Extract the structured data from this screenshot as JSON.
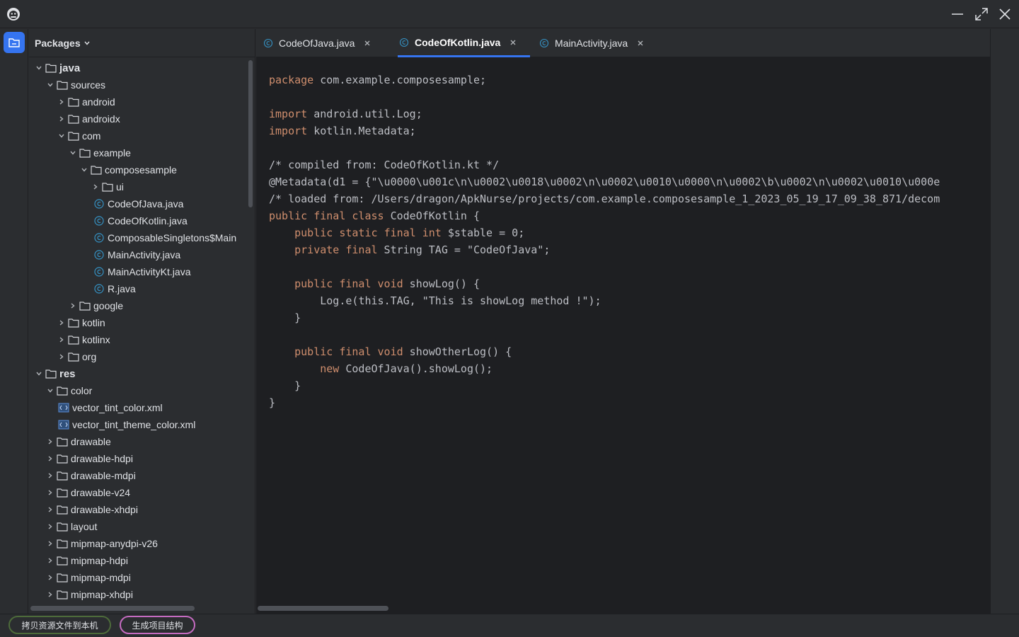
{
  "titlebar": {
    "logo_icon": "android-bug-icon",
    "buttons": [
      "minimize-icon",
      "maximize-icon",
      "close-icon"
    ]
  },
  "strip": {
    "active_icon": "folder-icon",
    "accent": "#3574f0"
  },
  "panel": {
    "title": "Packages",
    "tree": [
      {
        "label": "java",
        "depth": 0,
        "type": "folder",
        "expanded": true,
        "big": true
      },
      {
        "label": "sources",
        "depth": 1,
        "type": "folder",
        "expanded": true
      },
      {
        "label": "android",
        "depth": 2,
        "type": "folder",
        "expanded": false
      },
      {
        "label": "androidx",
        "depth": 2,
        "type": "folder",
        "expanded": false
      },
      {
        "label": "com",
        "depth": 2,
        "type": "folder",
        "expanded": true
      },
      {
        "label": "example",
        "depth": 3,
        "type": "folder",
        "expanded": true
      },
      {
        "label": "composesample",
        "depth": 4,
        "type": "folder",
        "expanded": true
      },
      {
        "label": "ui",
        "depth": 5,
        "type": "folder",
        "expanded": false
      },
      {
        "label": "CodeOfJava.java",
        "depth": 5,
        "type": "class"
      },
      {
        "label": "CodeOfKotlin.java",
        "depth": 5,
        "type": "class"
      },
      {
        "label": "ComposableSingletons$Main",
        "depth": 5,
        "type": "class"
      },
      {
        "label": "MainActivity.java",
        "depth": 5,
        "type": "class"
      },
      {
        "label": "MainActivityKt.java",
        "depth": 5,
        "type": "class"
      },
      {
        "label": "R.java",
        "depth": 5,
        "type": "class"
      },
      {
        "label": "google",
        "depth": 3,
        "type": "folder",
        "expanded": false
      },
      {
        "label": "kotlin",
        "depth": 2,
        "type": "folder",
        "expanded": false
      },
      {
        "label": "kotlinx",
        "depth": 2,
        "type": "folder",
        "expanded": false
      },
      {
        "label": "org",
        "depth": 2,
        "type": "folder",
        "expanded": false
      },
      {
        "label": "res",
        "depth": 0,
        "type": "folder",
        "expanded": true,
        "big": true
      },
      {
        "label": "color",
        "depth": 1,
        "type": "folder",
        "expanded": true
      },
      {
        "label": "vector_tint_color.xml",
        "depth": 2,
        "type": "xml"
      },
      {
        "label": "vector_tint_theme_color.xml",
        "depth": 2,
        "type": "xml"
      },
      {
        "label": "drawable",
        "depth": 1,
        "type": "folder",
        "expanded": false
      },
      {
        "label": "drawable-hdpi",
        "depth": 1,
        "type": "folder",
        "expanded": false
      },
      {
        "label": "drawable-mdpi",
        "depth": 1,
        "type": "folder",
        "expanded": false
      },
      {
        "label": "drawable-v24",
        "depth": 1,
        "type": "folder",
        "expanded": false
      },
      {
        "label": "drawable-xhdpi",
        "depth": 1,
        "type": "folder",
        "expanded": false
      },
      {
        "label": "layout",
        "depth": 1,
        "type": "folder",
        "expanded": false
      },
      {
        "label": "mipmap-anydpi-v26",
        "depth": 1,
        "type": "folder",
        "expanded": false
      },
      {
        "label": "mipmap-hdpi",
        "depth": 1,
        "type": "folder",
        "expanded": false
      },
      {
        "label": "mipmap-mdpi",
        "depth": 1,
        "type": "folder",
        "expanded": false
      },
      {
        "label": "mipmap-xhdpi",
        "depth": 1,
        "type": "folder",
        "expanded": false
      }
    ]
  },
  "editor": {
    "tabs": [
      {
        "label": "CodeOfJava.java",
        "active": false
      },
      {
        "label": "CodeOfKotlin.java",
        "active": true
      },
      {
        "label": "MainActivity.java",
        "active": false
      }
    ],
    "code_lines": [
      "package com.example.composesample;",
      "",
      "import android.util.Log;",
      "import kotlin.Metadata;",
      "",
      "/* compiled from: CodeOfKotlin.kt */",
      "@Metadata(d1 = {\"\\u0000\\u001c\\n\\u0002\\u0018\\u0002\\n\\u0002\\u0010\\u0000\\n\\u0002\\b\\u0002\\n\\u0002\\u0010\\u000e",
      "/* loaded from: /Users/dragon/ApkNurse/projects/com.example.composesample_1_2023_05_19_17_09_38_871/decom",
      "public final class CodeOfKotlin {",
      "    public static final int $stable = 0;",
      "    private final String TAG = \"CodeOfJava\";",
      "",
      "    public final void showLog() {",
      "        Log.e(this.TAG, \"This is showLog method !\");",
      "    }",
      "",
      "    public final void showOtherLog() {",
      "        new CodeOfJava().showLog();",
      "    }",
      "}"
    ],
    "keywords": [
      "package",
      "import",
      "public",
      "final",
      "class",
      "static",
      "int",
      "private",
      "void",
      "new"
    ],
    "colors": {
      "keyword": "#cf8e6d",
      "text": "#bcbec4",
      "background": "#1e1f22"
    }
  },
  "bottom": {
    "copy_button": "拷贝资源文件到本机",
    "generate_button": "生成项目结构"
  }
}
